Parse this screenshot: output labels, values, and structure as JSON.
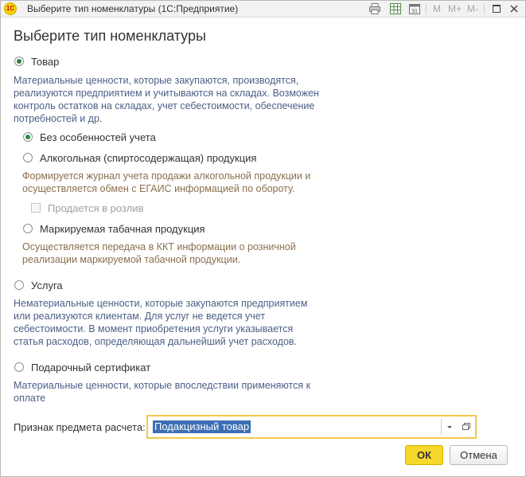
{
  "window": {
    "title": "Выберите тип номенклатуры  (1С:Предприятие)",
    "logo_text": "1С",
    "memory_buttons": [
      "M",
      "M+",
      "M-"
    ]
  },
  "heading": "Выберите тип номенклатуры",
  "options": {
    "goods": {
      "label": "Товар",
      "checked": true,
      "description": [
        "Материальные ценности, которые закупаются, производятся,",
        "реализуются предприятием и учитываются на складах. Возможен",
        "контроль остатков на складах, учет себестоимости, обеспечение",
        "потребностей и др."
      ],
      "sub_options": {
        "no_features": {
          "label": "Без особенностей учета",
          "checked": true
        },
        "alcohol": {
          "label": "Алкогольная (спиртосодержащая) продукция",
          "checked": false,
          "description": [
            "Формируется журнал учета продажи алкогольной продукции и",
            "осуществляется обмен с ЕГАИС информацией по обороту."
          ],
          "draft_checkbox": {
            "label": "Продается в розлив",
            "checked": false,
            "disabled": true
          }
        },
        "tobacco": {
          "label": "Маркируемая табачная продукция",
          "checked": false,
          "description": [
            "Осуществляется передача в ККТ информации о розничной",
            "реализации маркируемой табачной продукции."
          ]
        }
      }
    },
    "service": {
      "label": "Услуга",
      "checked": false,
      "description": [
        "Нематериальные ценности, которые закупаются предприятием",
        "или реализуются клиентам. Для услуг не ведется учет",
        "себестоимости. В момент приобретения услуги указывается",
        "статья расходов, определяющая дальнейший учет расходов."
      ]
    },
    "gift_certificate": {
      "label": "Подарочный сертификат",
      "checked": false,
      "description": [
        "Материальные ценности, которые впоследствии применяются к",
        "оплате"
      ]
    }
  },
  "payment_subject": {
    "label": "Признак предмета расчета:",
    "value": "Подакцизный товар"
  },
  "buttons": {
    "ok": "ОК",
    "cancel": "Отмена"
  },
  "colors": {
    "accent_yellow": "#f7d82a",
    "field_focus_border": "#f2c94c",
    "description_blue": "#4b5f87",
    "description_brown": "#8b6f4e",
    "radio_checked": "#2c8a3c",
    "selection": "#3d6eb5"
  },
  "icons": {
    "app_logo": "1c-logo-icon",
    "print": "print-icon",
    "spreadsheet": "spreadsheet-icon",
    "calendar": "calendar-icon",
    "maximize": "maximize-icon",
    "close": "close-icon",
    "dropdown": "chevron-down-icon",
    "open": "open-form-icon"
  }
}
